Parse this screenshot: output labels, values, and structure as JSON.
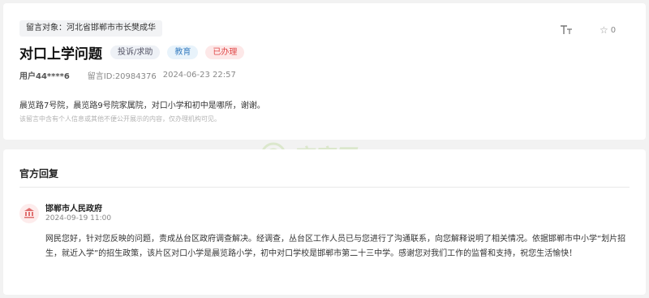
{
  "message": {
    "target": "留言对象：河北省邯郸市市长樊成华",
    "title": "对口上学问题",
    "tags": {
      "type": "投诉/求助",
      "category": "教育",
      "status": "已办理"
    },
    "user": "用户44****6",
    "message_id": "留言ID:20984376",
    "datetime": "2024-06-23 22:57",
    "content": "晨览路7号院，晨览路9号院家属院，对口小学和初中是哪所，谢谢。",
    "notice": "该留言中含有个人信息或其他不便公开展示的内容，仅办理机构可见。",
    "font_tool_label": "TT",
    "like_count": "0"
  },
  "watermark": {
    "text": "恋家网"
  },
  "reply": {
    "heading": "官方回复",
    "org": "邯郸市人民政府",
    "time": "2024-09-19 11:00",
    "body": "网民您好，针对您反映的问题，责成丛台区政府调查解决。经调查，丛台区工作人员已与您进行了沟通联系，向您解释说明了相关情况。依据邯郸市中小学“划片招生，就近入学”的招生政策，该片区对口小学是晨览路小学，初中对口学校是邯郸市第二十三中学。感谢您对我们工作的监督和支持，祝您生活愉快！"
  },
  "colors": {
    "status_red": "#e04848",
    "category_blue": "#3a7fc1",
    "avatar_bg": "#fdecec"
  },
  "icons": {
    "font_size": "font-size-icon",
    "like": "star-icon",
    "avatar": "government-building-icon"
  }
}
